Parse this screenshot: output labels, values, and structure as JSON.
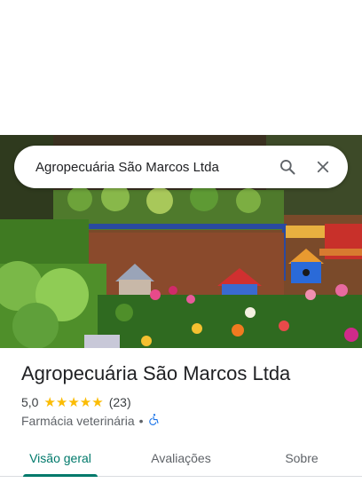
{
  "search": {
    "query": "Agropecuária São Marcos Ltda",
    "search_icon": "search-icon",
    "close_icon": "close-icon"
  },
  "place": {
    "name": "Agropecuária São Marcos Ltda",
    "rating": "5,0",
    "stars": 5,
    "reviews_count": "(23)",
    "category": "Farmácia veterinária",
    "separator": "•",
    "accessibility_icon": "wheelchair-icon"
  },
  "tabs": [
    {
      "label": "Visão geral",
      "active": true
    },
    {
      "label": "Avaliações",
      "active": false
    },
    {
      "label": "Sobre",
      "active": false
    }
  ],
  "colors": {
    "accent": "#00796b",
    "star": "#fbbc04",
    "accessibility": "#1a73e8"
  }
}
